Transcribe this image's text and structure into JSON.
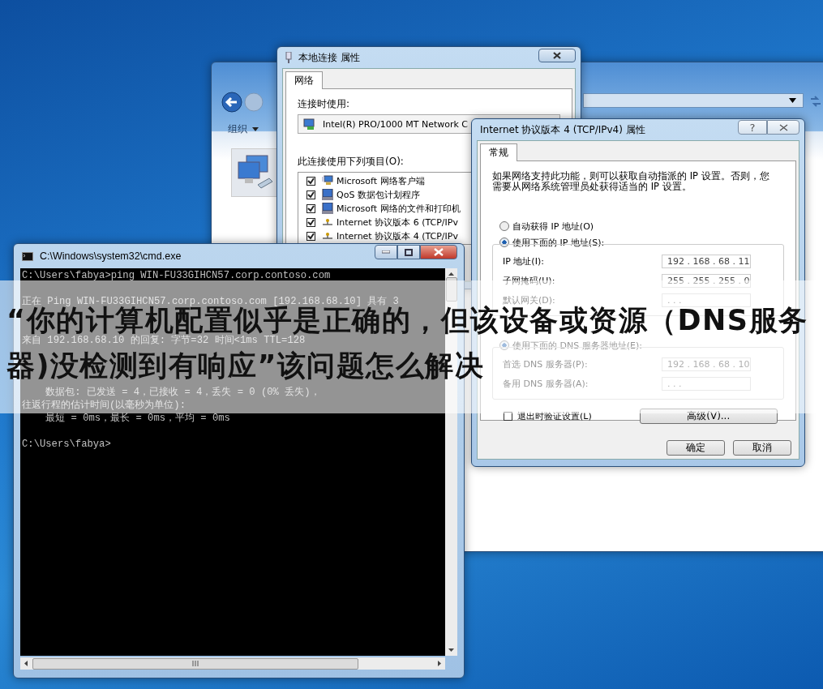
{
  "explorer": {
    "organize": "组织"
  },
  "properties_window": {
    "title": "本地连接 属性",
    "tabs": [
      {
        "label": "网络",
        "selected": true
      }
    ],
    "connect_using_label": "连接时使用:",
    "adapter": "Intel(R) PRO/1000 MT Network C",
    "items_label": "此连接使用下列项目(O):",
    "items": [
      {
        "label": "Microsoft 网络客户端",
        "checked": true,
        "kind": "client"
      },
      {
        "label": "QoS 数据包计划程序",
        "checked": true,
        "kind": "service"
      },
      {
        "label": "Microsoft 网络的文件和打印机",
        "checked": true,
        "kind": "service"
      },
      {
        "label": "Internet 协议版本 6 (TCP/IPv",
        "checked": true,
        "kind": "protocol"
      },
      {
        "label": "Internet 协议版本 4 (TCP/IPv",
        "checked": true,
        "kind": "protocol"
      }
    ]
  },
  "tcp_dialog": {
    "title": "Internet 协议版本 4 (TCP/IPv4) 属性",
    "help": "?",
    "tabs": [
      {
        "label": "常规",
        "selected": true
      }
    ],
    "description": "如果网络支持此功能，则可以获取自动指派的 IP 设置。否则，您需要从网络系统管理员处获得适当的 IP 设置。",
    "ip_options": [
      {
        "label": "自动获得 IP 地址(O)",
        "selected": false
      },
      {
        "label": "使用下面的 IP 地址(S):",
        "selected": true
      }
    ],
    "ip_fields": [
      {
        "label": "IP 地址(I):",
        "value": "192 . 168 . 68 . 11"
      },
      {
        "label": "子网掩码(U):",
        "value": "255 . 255 . 255 . 0"
      },
      {
        "label": "默认网关(D):",
        "value": ".   .   ."
      }
    ],
    "dns_options": [
      {
        "label": "使用下面的 DNS 服务器地址(E):",
        "selected": true
      }
    ],
    "dns_fields": [
      {
        "label": "首选 DNS 服务器(P):",
        "value": "192 . 168 . 68 . 10"
      },
      {
        "label": "备用 DNS 服务器(A):",
        "value": ".   .   ."
      }
    ],
    "validate": {
      "label": "退出时验证设置(L)",
      "checked": false
    },
    "advanced": "高级(V)...",
    "buttons": [
      "确定",
      "取消"
    ]
  },
  "cmd": {
    "title": "C:\\Windows\\system32\\cmd.exe",
    "lines": [
      {
        "kind": "text",
        "text": "C:\\Users\\fabya>ping WIN-FU33GIHCN57.corp.contoso.com"
      },
      {
        "kind": "blank"
      },
      {
        "kind": "text",
        "text": "正在 Ping WIN-FU33GIHCN57.corp.contoso.com [192.168.68.10] 具有 3"
      },
      {
        "kind": "blank"
      },
      {
        "kind": "blank"
      },
      {
        "kind": "text",
        "text": "来自 192.168.68.10 的回复: 字节=32 时间<1ms TTL=128"
      },
      {
        "kind": "blank"
      },
      {
        "kind": "blank"
      },
      {
        "kind": "blank"
      },
      {
        "kind": "text",
        "text": "    数据包: 已发送 = 4，已接收 = 4，丢失 = 0 (0% 丢失)，"
      },
      {
        "kind": "text",
        "text": "往返行程的估计时间(以毫秒为单位):"
      },
      {
        "kind": "text",
        "text": "    最短 = 0ms，最长 = 0ms，平均 = 0ms"
      },
      {
        "kind": "blank"
      },
      {
        "kind": "text",
        "text": "C:\\Users\\fabya>"
      }
    ]
  },
  "banner": {
    "lines": [
      "“你的计算机配置似乎是正确的，但该设备或资源（DNS服务",
      "器)没检测到有响应”该问题怎么解决"
    ]
  }
}
